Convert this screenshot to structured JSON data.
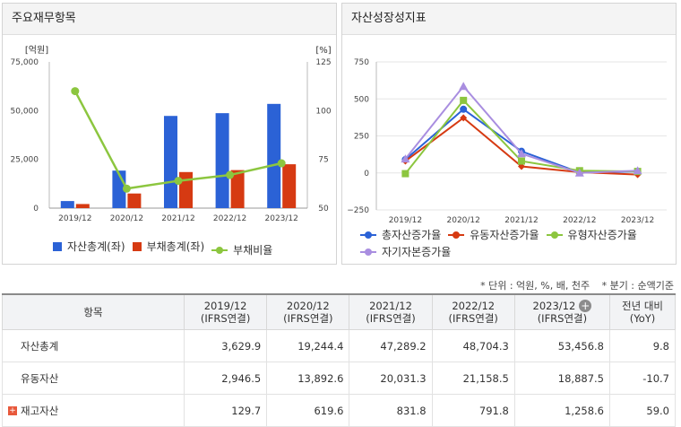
{
  "left_panel": {
    "title": "주요재무항목",
    "legend": [
      {
        "label": "자산총계(좌)",
        "color": "#2b62d6",
        "kind": "square"
      },
      {
        "label": "부채총계(좌)",
        "color": "#d63a12",
        "kind": "square"
      },
      {
        "label": "부채비율",
        "color": "#8cc63f",
        "kind": "line"
      }
    ]
  },
  "right_panel": {
    "title": "자산성장성지표",
    "legend": [
      {
        "label": "총자산증가율",
        "color": "#2b62d6",
        "kind": "line"
      },
      {
        "label": "유동자산증가율",
        "color": "#d63a12",
        "kind": "line"
      },
      {
        "label": "유형자산증가율",
        "color": "#8cc63f",
        "kind": "line"
      },
      {
        "label": "자기자본증가율",
        "color": "#a98ee0",
        "kind": "line"
      }
    ]
  },
  "notes": {
    "unit": "* 단위 : 억원, %, 배, 천주",
    "period": "* 분기 : 순액기준"
  },
  "chart_data": [
    {
      "type": "bar",
      "categories": [
        "2019/12",
        "2020/12",
        "2021/12",
        "2022/12",
        "2023/12"
      ],
      "series": [
        {
          "name": "자산총계(좌)",
          "values": [
            3629.9,
            19244.4,
            47289.2,
            48704.3,
            53456.8
          ],
          "color": "#2b62d6",
          "axis": "left"
        },
        {
          "name": "부채총계(좌)",
          "values": [
            2100,
            7500,
            18500,
            19500,
            22500
          ],
          "color": "#d63a12",
          "axis": "left"
        },
        {
          "name": "부채비율",
          "values": [
            110,
            60,
            64,
            67,
            73
          ],
          "color": "#8cc63f",
          "axis": "right",
          "type": "line"
        }
      ],
      "ylabel_left": "[억원]",
      "ylabel_right": "[%]",
      "ylim_left": [
        0,
        75000
      ],
      "ylim_right": [
        50,
        125
      ],
      "yticks_left": [
        "0",
        "25,000",
        "50,000",
        "75,000"
      ],
      "yticks_right": [
        "50",
        "75",
        "100",
        "125"
      ],
      "grid": false
    },
    {
      "type": "line",
      "categories": [
        "2019/12",
        "2020/12",
        "2021/12",
        "2022/12",
        "2023/12"
      ],
      "series": [
        {
          "name": "총자산증가율",
          "values": [
            90,
            430,
            146,
            3,
            10
          ],
          "color": "#2b62d6",
          "marker": "circle"
        },
        {
          "name": "유동자산증가율",
          "values": [
            80,
            372,
            44,
            5,
            -11
          ],
          "color": "#d63a12",
          "marker": "diamond"
        },
        {
          "name": "유형자산증가율",
          "values": [
            -5,
            490,
            80,
            15,
            10
          ],
          "color": "#8cc63f",
          "marker": "square"
        },
        {
          "name": "자기자본증가율",
          "values": [
            95,
            585,
            130,
            0,
            15
          ],
          "color": "#a98ee0",
          "marker": "triangle"
        }
      ],
      "ylim": [
        -250,
        750
      ],
      "yticks": [
        "−250",
        "0",
        "250",
        "500",
        "750"
      ],
      "grid": true
    }
  ],
  "table": {
    "header": {
      "item": "항목",
      "cols": [
        {
          "year": "2019/12",
          "basis": "(IFRS연결)"
        },
        {
          "year": "2020/12",
          "basis": "(IFRS연결)"
        },
        {
          "year": "2021/12",
          "basis": "(IFRS연결)"
        },
        {
          "year": "2022/12",
          "basis": "(IFRS연결)"
        },
        {
          "year": "2023/12",
          "basis": "(IFRS연결)"
        }
      ],
      "yoy": "전년 대비",
      "yoy_sub": "(YoY)"
    },
    "rows": [
      {
        "name": "자산총계",
        "values": [
          "3,629.9",
          "19,244.4",
          "47,289.2",
          "48,704.3",
          "53,456.8"
        ],
        "yoy": "9.8",
        "expandable": false
      },
      {
        "name": "유동자산",
        "values": [
          "2,946.5",
          "13,892.6",
          "20,031.3",
          "21,158.5",
          "18,887.5"
        ],
        "yoy": "-10.7",
        "expandable": false
      },
      {
        "name": "재고자산",
        "values": [
          "129.7",
          "619.6",
          "831.8",
          "791.8",
          "1,258.6"
        ],
        "yoy": "59.0",
        "expandable": true
      }
    ]
  }
}
